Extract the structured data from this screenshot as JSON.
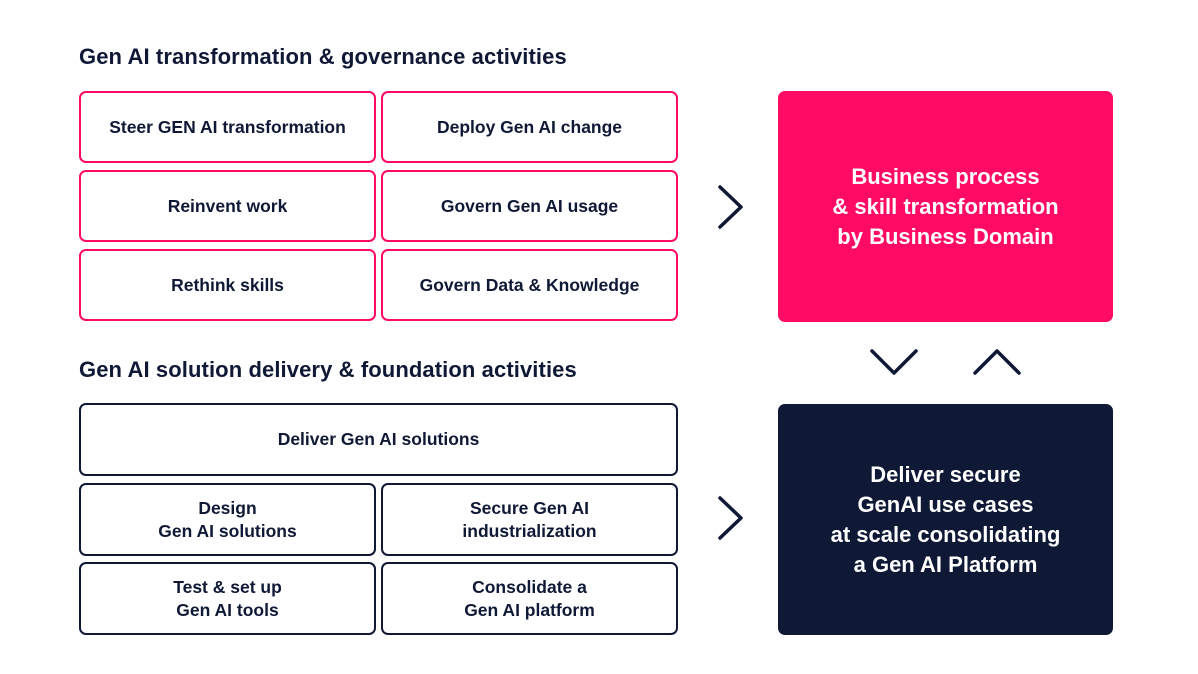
{
  "colors": {
    "accent_pink": "#ff0a64",
    "navy": "#0f1936",
    "background": "#ffffff"
  },
  "governance": {
    "heading": "Gen AI transformation & governance activities",
    "boxes": [
      "Steer GEN AI transformation",
      "Deploy Gen AI change",
      "Reinvent work",
      "Govern Gen AI usage",
      "Rethink skills",
      "Govern Data & Knowledge"
    ],
    "outcome": "Business process\n& skill transformation\nby Business Domain"
  },
  "delivery": {
    "heading": "Gen AI solution delivery & foundation activities",
    "wide_box": "Deliver Gen AI solutions",
    "boxes": [
      "Design\nGen AI solutions",
      "Secure Gen AI\nindustrialization",
      "Test & set up\nGen AI tools",
      "Consolidate a\nGen AI platform"
    ],
    "outcome": "Deliver secure\nGenAI use cases\nat scale consolidating\na Gen AI Platform"
  },
  "icons": {
    "arrow_top": "chevron-right-icon",
    "arrow_bottom": "chevron-right-icon",
    "arrow_down": "chevron-down-icon",
    "arrow_up": "chevron-up-icon"
  }
}
